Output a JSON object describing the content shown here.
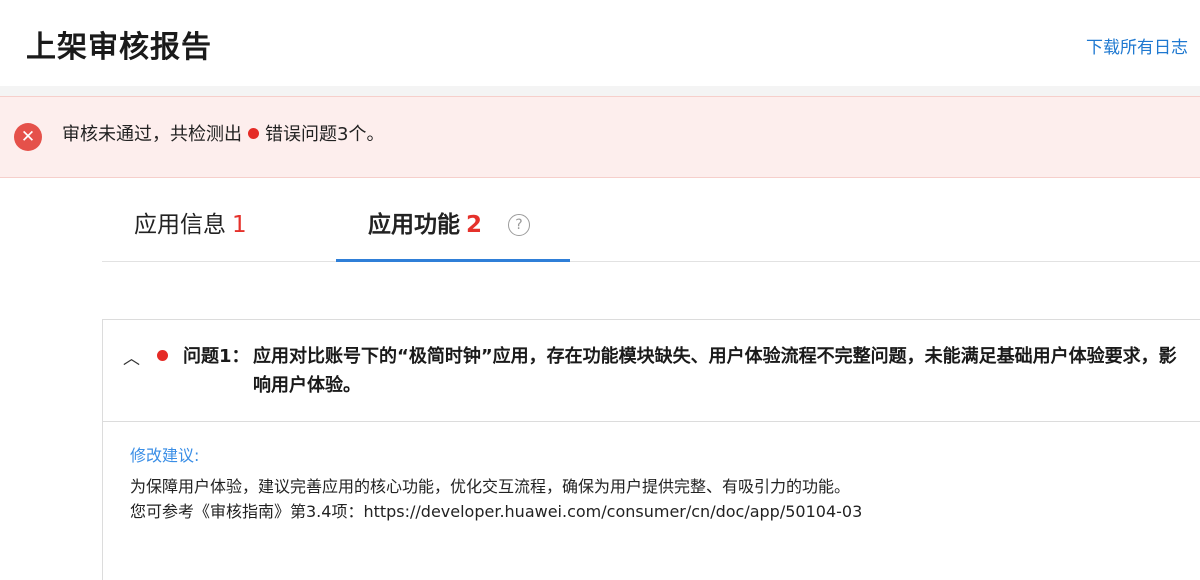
{
  "header": {
    "title": "上架审核报告",
    "download_label": "下载所有日志"
  },
  "alert": {
    "icon": "close-circle-icon",
    "text_before": "审核未通过，共检测出",
    "text_after": "错误问题3个。",
    "dot_color": "#e52b26"
  },
  "tabs": [
    {
      "label": "应用信息",
      "count": "1",
      "active": false
    },
    {
      "label": "应用功能",
      "count": "2",
      "active": true,
      "help_icon": "question-circle-icon"
    }
  ],
  "issue": {
    "collapse_icon": "chevron-up-icon",
    "label": "问题1：",
    "text": "应用对比账号下的“极简时钟”应用，存在功能模块缺失、用户体验流程不完整问题，未能满足基础用户体验要求，影响用户体验。",
    "suggestion_title": "修改建议:",
    "suggestion_lines": [
      "为保障用户体验，建议完善应用的核心功能，优化交互流程，确保为用户提供完整、有吸引力的功能。",
      "您可参考《审核指南》第3.4项：https://developer.huawei.com/consumer/cn/doc/app/50104-03"
    ]
  },
  "colors": {
    "accent": "#2f7fd8",
    "error": "#e5312b",
    "alert_bg": "#fdeeed",
    "link": "#1e78d0"
  }
}
